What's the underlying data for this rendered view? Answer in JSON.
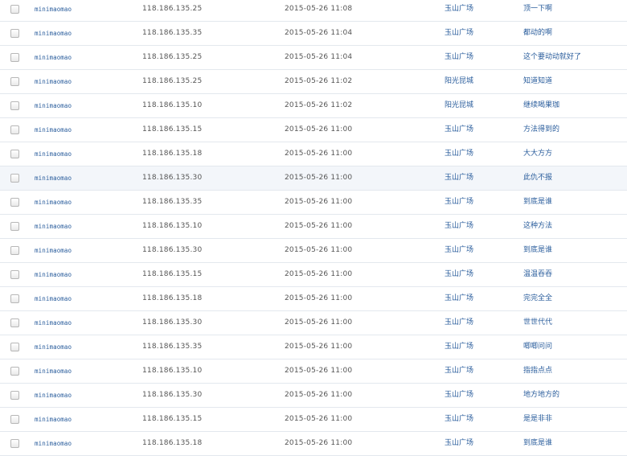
{
  "rows": [
    {
      "user": "minimaomao",
      "ip": "118.186.135.25",
      "time": "2015-05-26 11:08",
      "location": "玉山广场",
      "message": "顶一下啊"
    },
    {
      "user": "minimaomao",
      "ip": "118.186.135.35",
      "time": "2015-05-26 11:04",
      "location": "玉山广场",
      "message": "都动的啊"
    },
    {
      "user": "minimaomao",
      "ip": "118.186.135.25",
      "time": "2015-05-26 11:04",
      "location": "玉山广场",
      "message": "这个要动动就好了"
    },
    {
      "user": "minimaomao",
      "ip": "118.186.135.25",
      "time": "2015-05-26 11:02",
      "location": "阳光昆城",
      "message": "知道知道"
    },
    {
      "user": "minimaomao",
      "ip": "118.186.135.10",
      "time": "2015-05-26 11:02",
      "location": "阳光昆城",
      "message": "继续喝果珈"
    },
    {
      "user": "minimaomao",
      "ip": "118.186.135.15",
      "time": "2015-05-26 11:00",
      "location": "玉山广场",
      "message": "方法得到的"
    },
    {
      "user": "minimaomao",
      "ip": "118.186.135.18",
      "time": "2015-05-26 11:00",
      "location": "玉山广场",
      "message": "大大方方"
    },
    {
      "user": "minimaomao",
      "ip": "118.186.135.30",
      "time": "2015-05-26 11:00",
      "location": "玉山广场",
      "message": "此仇不报"
    },
    {
      "user": "minimaomao",
      "ip": "118.186.135.35",
      "time": "2015-05-26 11:00",
      "location": "玉山广场",
      "message": "到底是谁"
    },
    {
      "user": "minimaomao",
      "ip": "118.186.135.10",
      "time": "2015-05-26 11:00",
      "location": "玉山广场",
      "message": "这种方法"
    },
    {
      "user": "minimaomao",
      "ip": "118.186.135.30",
      "time": "2015-05-26 11:00",
      "location": "玉山广场",
      "message": "到底是谁"
    },
    {
      "user": "minimaomao",
      "ip": "118.186.135.15",
      "time": "2015-05-26 11:00",
      "location": "玉山广场",
      "message": "温温吞吞"
    },
    {
      "user": "minimaomao",
      "ip": "118.186.135.18",
      "time": "2015-05-26 11:00",
      "location": "玉山广场",
      "message": "完完全全"
    },
    {
      "user": "minimaomao",
      "ip": "118.186.135.30",
      "time": "2015-05-26 11:00",
      "location": "玉山广场",
      "message": "世世代代"
    },
    {
      "user": "minimaomao",
      "ip": "118.186.135.35",
      "time": "2015-05-26 11:00",
      "location": "玉山广场",
      "message": "唧唧问问"
    },
    {
      "user": "minimaomao",
      "ip": "118.186.135.10",
      "time": "2015-05-26 11:00",
      "location": "玉山广场",
      "message": "指指点点"
    },
    {
      "user": "minimaomao",
      "ip": "118.186.135.30",
      "time": "2015-05-26 11:00",
      "location": "玉山广场",
      "message": "地方地方的"
    },
    {
      "user": "minimaomao",
      "ip": "118.186.135.15",
      "time": "2015-05-26 11:00",
      "location": "玉山广场",
      "message": "是是非非"
    },
    {
      "user": "minimaomao",
      "ip": "118.186.135.18",
      "time": "2015-05-26 11:00",
      "location": "玉山广场",
      "message": "到底是谁"
    }
  ],
  "highlighted_row": 7,
  "colors": {
    "link": "#2a5d9c",
    "text": "#555555",
    "row_border": "#e3e8ee",
    "row_highlight": "#f3f6fa"
  }
}
